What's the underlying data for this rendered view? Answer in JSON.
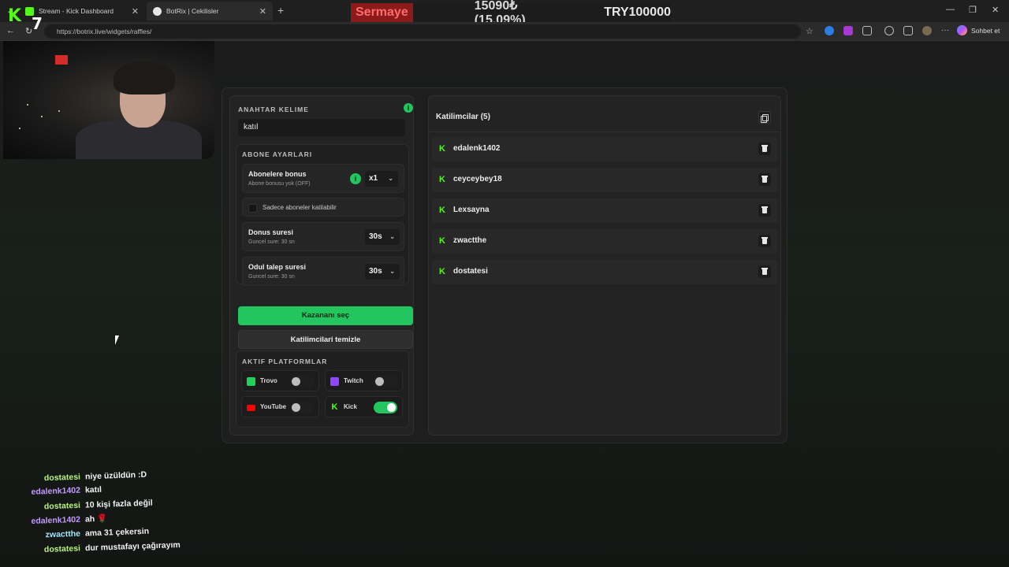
{
  "browser": {
    "tabs": [
      {
        "label": "Stream - Kick Dashboard",
        "active": false
      },
      {
        "label": "BotRix | Cekilisler",
        "active": true
      }
    ],
    "url": "https://botrix.live/widgets/raffles/",
    "copilot_label": "Sohbet et"
  },
  "ticker": {
    "label": "Sermaye",
    "change": "15090₺ (15.09%)",
    "total": "TRY100000"
  },
  "overlay": {
    "logo_text": "K",
    "logo_number": "7"
  },
  "raffle": {
    "keyword_label": "ANAHTAR KELIME",
    "keyword_value": "katıl",
    "subs_section_label": "ABONE AYARLARI",
    "sub_bonus": {
      "title": "Abonelere bonus",
      "subtitle": "Abone bonusu yok (OFF)",
      "value": "x1"
    },
    "subs_only_label": "Sadece aboneler katilabilir",
    "bonus_time": {
      "title": "Donus suresi",
      "subtitle": "Guncel sure: 30 sn",
      "value": "30s"
    },
    "claim_time": {
      "title": "Odul talep suresi",
      "subtitle": "Guncel sure: 30 sn",
      "value": "30s"
    },
    "pick_winner_label": "Kazananı seç",
    "clear_label": "Katilimcilari temizle",
    "platforms_label": "AKTIF PLATFORMLAR",
    "platforms": [
      {
        "name": "Trovo",
        "enabled": false,
        "color": "#1fd35a"
      },
      {
        "name": "Twitch",
        "enabled": false,
        "color": "#9146ff"
      },
      {
        "name": "YouTube",
        "enabled": false,
        "color": "#ff0000"
      },
      {
        "name": "Kick",
        "enabled": true,
        "color": "#53fc18"
      }
    ],
    "participants_title": "Katilimcilar (5)",
    "participants": [
      "edalenk1402",
      "ceyceybey18",
      "Lexsayna",
      "zwactthe",
      "dostatesi"
    ]
  },
  "chat": [
    {
      "user": "dostatesi",
      "msg": "niye üzüldün :D",
      "color": "#b6f27a"
    },
    {
      "user": "edalenk1402",
      "msg": "katıl",
      "color": "#c39bff"
    },
    {
      "user": "dostatesi",
      "msg": "10 kişi fazla değil",
      "color": "#b6f27a"
    },
    {
      "user": "edalenk1402",
      "msg": "ah 🌹",
      "color": "#c39bff"
    },
    {
      "user": "zwactthe",
      "msg": "ama 31 çekersin",
      "color": "#9ee6ff"
    },
    {
      "user": "dostatesi",
      "msg": "dur mustafayı çağırayım",
      "color": "#b6f27a"
    }
  ],
  "colors": {
    "accent": "#22c55e",
    "kick": "#53fc18",
    "ticker_red": "#8b1b1b"
  }
}
